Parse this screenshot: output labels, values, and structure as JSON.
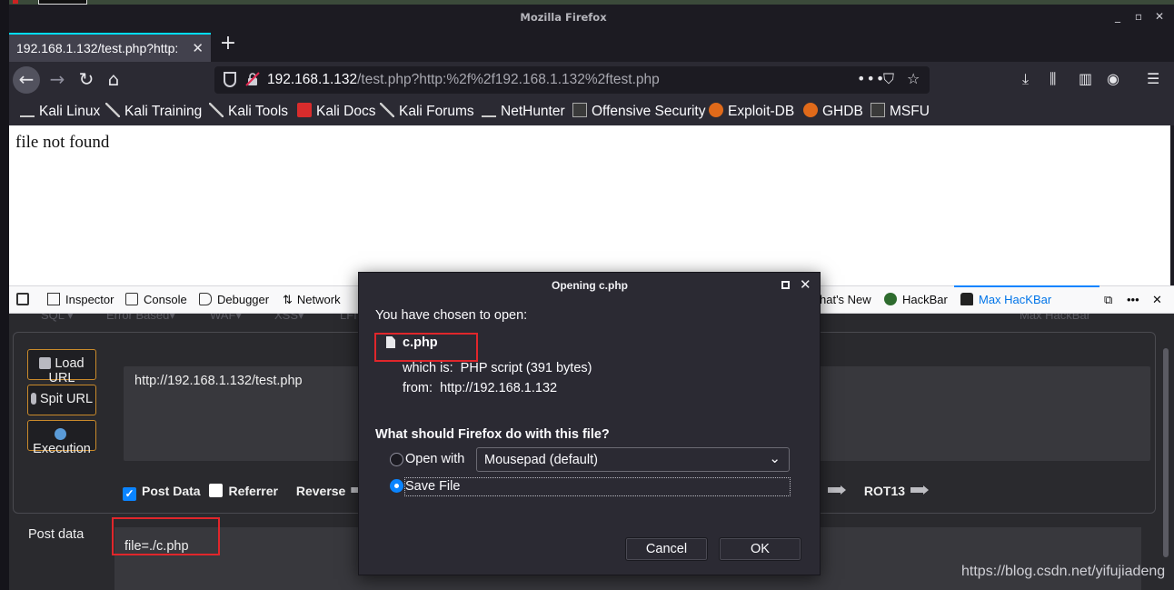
{
  "window": {
    "title": "Mozilla Firefox"
  },
  "tab": {
    "title": "192.168.1.132/test.php?http:"
  },
  "urlbar": {
    "host": "192.168.1.132",
    "path": "/test.php?http:%2f%2f192.168.1.132%2ftest.php",
    "more": "•••"
  },
  "bookmarks": [
    "Kali Linux",
    "Kali Training",
    "Kali Tools",
    "Kali Docs",
    "Kali Forums",
    "NetHunter",
    "Offensive Security",
    "Exploit-DB",
    "GHDB",
    "MSFU"
  ],
  "page": {
    "text": "file not found"
  },
  "devtools": {
    "tabs": [
      "Inspector",
      "Console",
      "Debugger",
      "Network"
    ],
    "right_tabs": [
      "hat's New",
      "HackBar",
      "Max HacKBar"
    ]
  },
  "hackbar": {
    "menu": [
      "SQL ▾",
      "Error Based▾",
      "WAF▾",
      "XSS▾",
      "LFI",
      "Max HackBar"
    ],
    "load_url": "Load URL",
    "split_url": "Spit URL",
    "execution": "Execution",
    "url_value": "http://192.168.1.132/test.php",
    "post_data_check": "Post Data",
    "referrer_check": "Referrer",
    "reverse": "Reverse",
    "rot13": "ROT13",
    "post_label": "Post data",
    "post_value": "file=./c.php"
  },
  "dialog": {
    "title": "Opening c.php",
    "chosen": "You have chosen to open:",
    "filename": "c.php",
    "which_is_label": "which is:",
    "which_is_value": "PHP script (391 bytes)",
    "from_label": "from:",
    "from_value": "http://192.168.1.132",
    "question": "What should Firefox do with this file?",
    "open_with": "Open with",
    "open_with_app": "Mousepad (default)",
    "save_file": "Save File",
    "cancel": "Cancel",
    "ok": "OK"
  },
  "watermark": "https://blog.csdn.net/yifujiadeng",
  "colors": {
    "accent": "#0a84ff",
    "highlight_box": "#e0262b",
    "hackbar_border": "#c98a2b"
  }
}
